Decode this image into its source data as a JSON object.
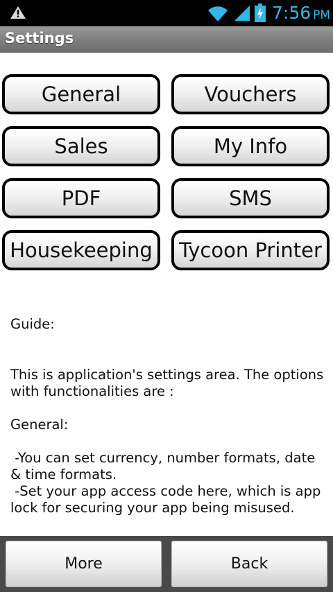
{
  "status_bar": {
    "time": "7:56",
    "ampm": "PM",
    "icons": [
      "warning-icon",
      "wifi-icon",
      "signal-icon",
      "battery-charging-icon"
    ],
    "accent_color": "#33b5e5"
  },
  "title_bar": {
    "title": "Settings"
  },
  "buttons": {
    "general": "General",
    "vouchers": "Vouchers",
    "sales": "Sales",
    "my_info": "My Info",
    "pdf": "PDF",
    "sms": "SMS",
    "housekeeping": "Housekeeping",
    "tycoon_printer": "Tycoon Printer"
  },
  "guide": {
    "heading": "Guide:",
    "intro": "This is application's settings area. The options with functionalities are :",
    "general_heading": "General:",
    "general_line1": " -You can set currency, number formats, date & time formats.",
    "general_line2": " -Set your app access code here, which is app lock for securing your app being misused."
  },
  "bottom_bar": {
    "more_label": "More",
    "back_label": "Back"
  }
}
